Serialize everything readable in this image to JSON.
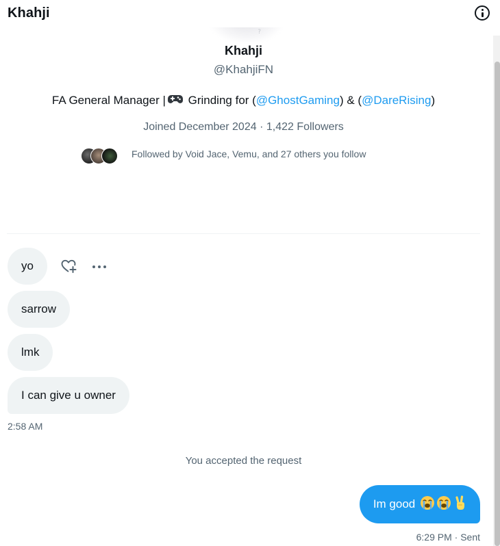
{
  "header": {
    "title": "Khahji",
    "info_icon": "info-icon"
  },
  "profile": {
    "name": "Khahji",
    "handle": "@KhahjiFN",
    "bio": {
      "prefix": "FA General Manager |",
      "gamepad_icon": "gamepad-icon",
      "middle": " Grinding for (",
      "link1": "@GhostGaming",
      "between": ") & (",
      "link2": "@DareRising",
      "suffix": ")"
    },
    "meta": "Joined December 2024 · 1,422 Followers",
    "followed_by": "Followed by Void Jace, Vemu, and 27 others you follow"
  },
  "messages": {
    "incoming": [
      "yo",
      "sarrow",
      "lmk",
      "I can give u owner"
    ],
    "incoming_time": "2:58 AM",
    "actions": {
      "react_icon": "heart-plus-icon",
      "more_icon": "more-icon"
    },
    "system": "You accepted the request",
    "outgoing": {
      "text": "Im good",
      "emojis": [
        "loudly-crying-face",
        "loudly-crying-face",
        "victory-hand"
      ]
    },
    "outgoing_status": "6:29 PM · Sent"
  },
  "colors": {
    "accent": "#1d9bf0",
    "text": "#0f1419",
    "secondary": "#536471",
    "bubble_in": "#eff3f4"
  }
}
